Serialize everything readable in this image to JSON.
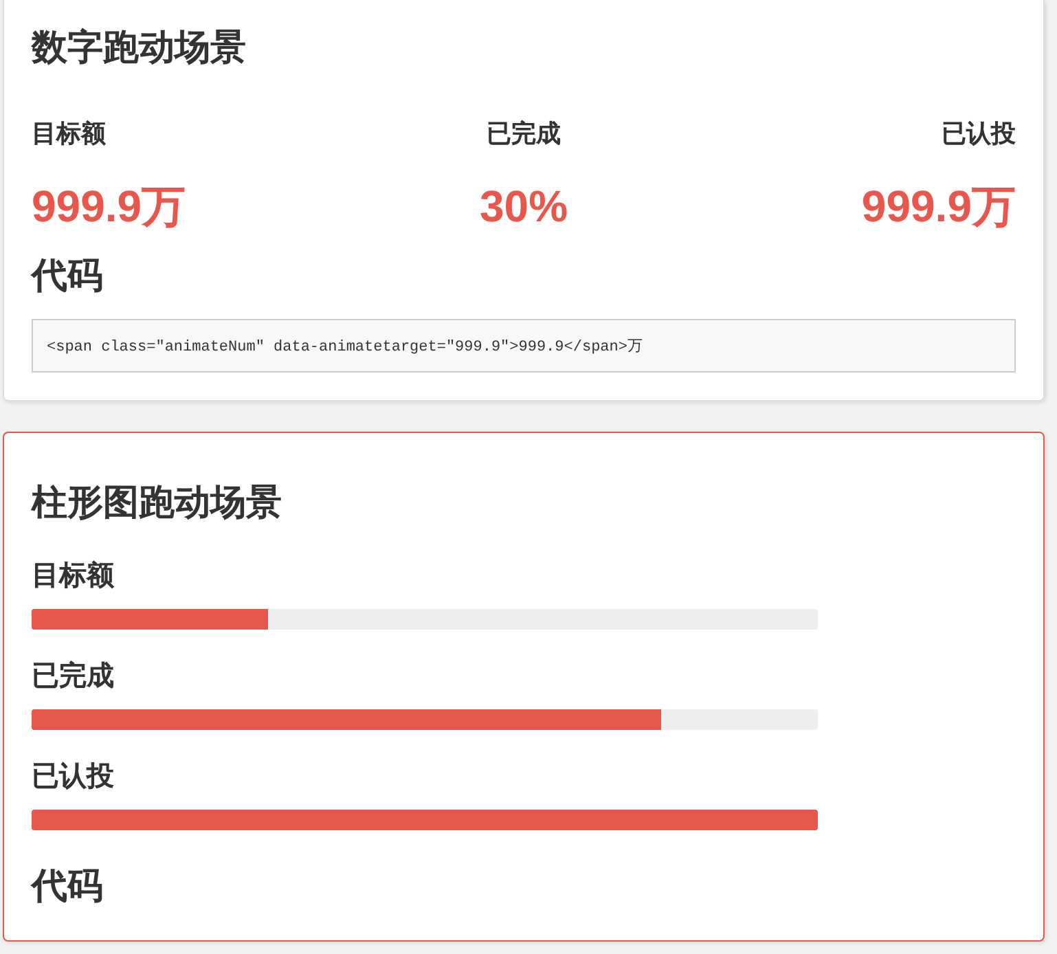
{
  "number_section": {
    "title": "数字跑动场景",
    "stats": [
      {
        "label": "目标额",
        "value": "999.9万"
      },
      {
        "label": "已完成",
        "value": "30%"
      },
      {
        "label": "已认投",
        "value": "999.9万"
      }
    ],
    "code_heading": "代码",
    "code": "<span class=\"animateNum\" data-animatetarget=\"999.9\">999.9</span>万"
  },
  "bar_section": {
    "title": "柱形图跑动场景",
    "bars": [
      {
        "label": "目标额",
        "level": 0.3
      },
      {
        "label": "已完成",
        "level": 0.8
      },
      {
        "label": "已认投",
        "level": 1
      }
    ],
    "code_heading": "代码"
  }
}
